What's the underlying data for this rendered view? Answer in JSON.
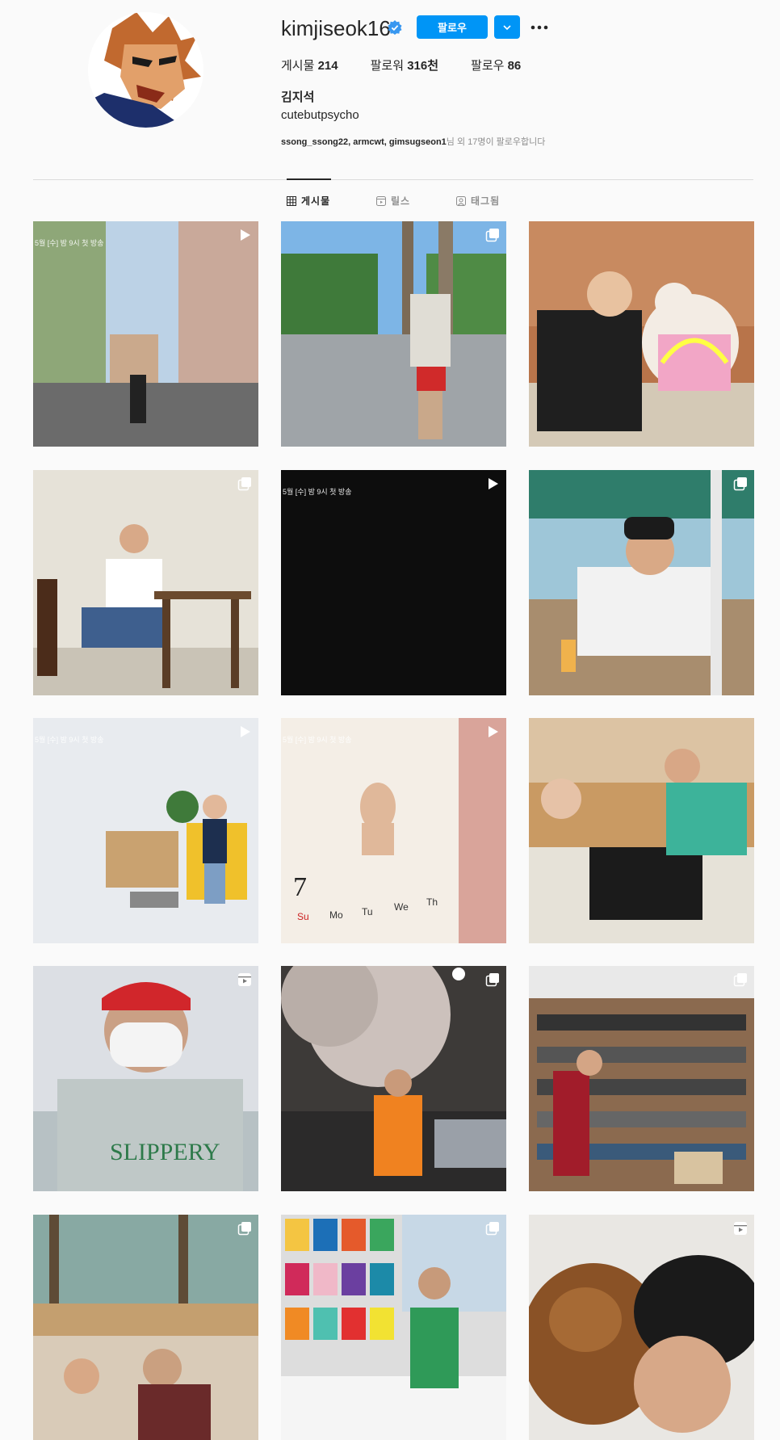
{
  "profile": {
    "username": "kimjiseok16",
    "follow_label": "팔로우",
    "posts_label": "게시물",
    "posts_count": "214",
    "followers_label": "팔로워",
    "followers_count": "316천",
    "following_label": "팔로우",
    "following_count": "86",
    "full_name": "김지석",
    "bio": "cutebutpsycho",
    "followed_by_names": "ssong_ssong22, armcwt, gimsugseon1",
    "followed_by_suffix": "님 외 17명이 팔로우합니다"
  },
  "tabs": [
    {
      "label": "게시물",
      "icon": "grid-icon",
      "active": true
    },
    {
      "label": "릴스",
      "icon": "reels-icon",
      "active": false
    },
    {
      "label": "태그됨",
      "icon": "tagged-icon",
      "active": false
    }
  ],
  "posts": [
    {
      "badge": "video-icon",
      "overlay": "5월 [수] 밤 9시 첫 방송"
    },
    {
      "badge": "carousel-icon",
      "overlay": ""
    },
    {
      "badge": "none",
      "overlay": ""
    },
    {
      "badge": "carousel-icon",
      "overlay": ""
    },
    {
      "badge": "video-icon",
      "overlay": "5월 [수] 밤 9시 첫 방송"
    },
    {
      "badge": "carousel-icon",
      "overlay": ""
    },
    {
      "badge": "video-icon",
      "overlay": "5월 [수] 밤 9시 첫 방송"
    },
    {
      "badge": "video-icon",
      "overlay": "5월 [수] 밤 9시 첫 방송"
    },
    {
      "badge": "none",
      "overlay": ""
    },
    {
      "badge": "reels-icon",
      "overlay": ""
    },
    {
      "badge": "carousel-icon",
      "overlay": ""
    },
    {
      "badge": "carousel-icon",
      "overlay": ""
    },
    {
      "badge": "carousel-icon",
      "overlay": ""
    },
    {
      "badge": "carousel-icon",
      "overlay": ""
    },
    {
      "badge": "reels-icon",
      "overlay": ""
    }
  ],
  "colors": {
    "accent": "#0095f6",
    "text": "#262626",
    "muted": "#8e8e8e"
  }
}
